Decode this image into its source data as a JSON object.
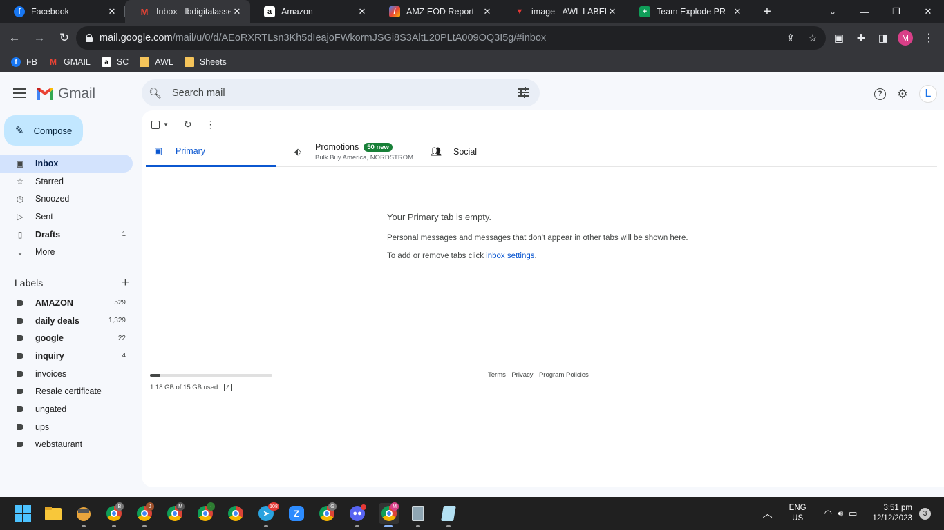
{
  "browser": {
    "tabs": [
      {
        "title": "Facebook",
        "icon": "facebook-icon"
      },
      {
        "title": "Inbox - lbdigitalassets",
        "icon": "gmail-icon"
      },
      {
        "title": "Amazon",
        "icon": "amazon-icon"
      },
      {
        "title": "AMZ EOD Report",
        "icon": "report-icon"
      },
      {
        "title": "image - AWL LABEL",
        "icon": "image-icon"
      },
      {
        "title": "Team Explode PR - G",
        "icon": "sheets-icon"
      }
    ],
    "url_host": "mail.google.com",
    "url_path": "/mail/u/0/d/AEoRXRTLsn3Kh5dIeajoFWkormJSGi8S3AltL20PLtA009OQ3I5g/#inbox",
    "profile_initial": "M",
    "bookmarks": [
      {
        "label": "FB",
        "icon": "facebook-icon"
      },
      {
        "label": "GMAIL",
        "icon": "gmail-icon"
      },
      {
        "label": "SC",
        "icon": "amazon-icon"
      },
      {
        "label": "AWL",
        "icon": "folder-icon"
      },
      {
        "label": "Sheets",
        "icon": "folder-icon"
      }
    ]
  },
  "gmail": {
    "logo_text": "Gmail",
    "search_placeholder": "Search mail",
    "account_initial": "L",
    "compose_label": "Compose",
    "nav": [
      {
        "label": "Inbox",
        "count": "",
        "icon": "inbox-icon"
      },
      {
        "label": "Starred",
        "count": "",
        "icon": "star-icon"
      },
      {
        "label": "Snoozed",
        "count": "",
        "icon": "clock-icon"
      },
      {
        "label": "Sent",
        "count": "",
        "icon": "send-icon"
      },
      {
        "label": "Drafts",
        "count": "1",
        "icon": "draft-icon"
      },
      {
        "label": "More",
        "count": "",
        "icon": "chevron-down-icon"
      }
    ],
    "labels_header": "Labels",
    "labels": [
      {
        "label": "AMAZON",
        "count": "529"
      },
      {
        "label": "daily deals",
        "count": "1,329"
      },
      {
        "label": "google",
        "count": "22"
      },
      {
        "label": "inquiry",
        "count": "4"
      },
      {
        "label": "invoices",
        "count": ""
      },
      {
        "label": "Resale certificate",
        "count": ""
      },
      {
        "label": "ungated",
        "count": ""
      },
      {
        "label": "ups",
        "count": ""
      },
      {
        "label": "webstaurant",
        "count": ""
      }
    ],
    "tabs": {
      "primary": "Primary",
      "promotions": "Promotions",
      "promotions_badge": "50 new",
      "promotions_senders": "Bulk Buy America, NORDSTROM…",
      "social": "Social"
    },
    "empty": {
      "heading": "Your Primary tab is empty.",
      "line1": "Personal messages and messages that don't appear in other tabs will be shown here.",
      "line2_prefix": "To add or remove tabs click ",
      "line2_link": "inbox settings",
      "line2_suffix": "."
    },
    "storage": {
      "text": "1.18 GB of 15 GB used",
      "fraction": 0.079
    },
    "footer": {
      "terms": "Terms",
      "privacy": "Privacy",
      "policies": "Program Policies",
      "sep": " · "
    }
  },
  "taskbar": {
    "lang": "ENG",
    "region": "US",
    "time": "3:51 pm",
    "date": "12/12/2023",
    "notif_count": "3",
    "telegram_badge": "108"
  }
}
